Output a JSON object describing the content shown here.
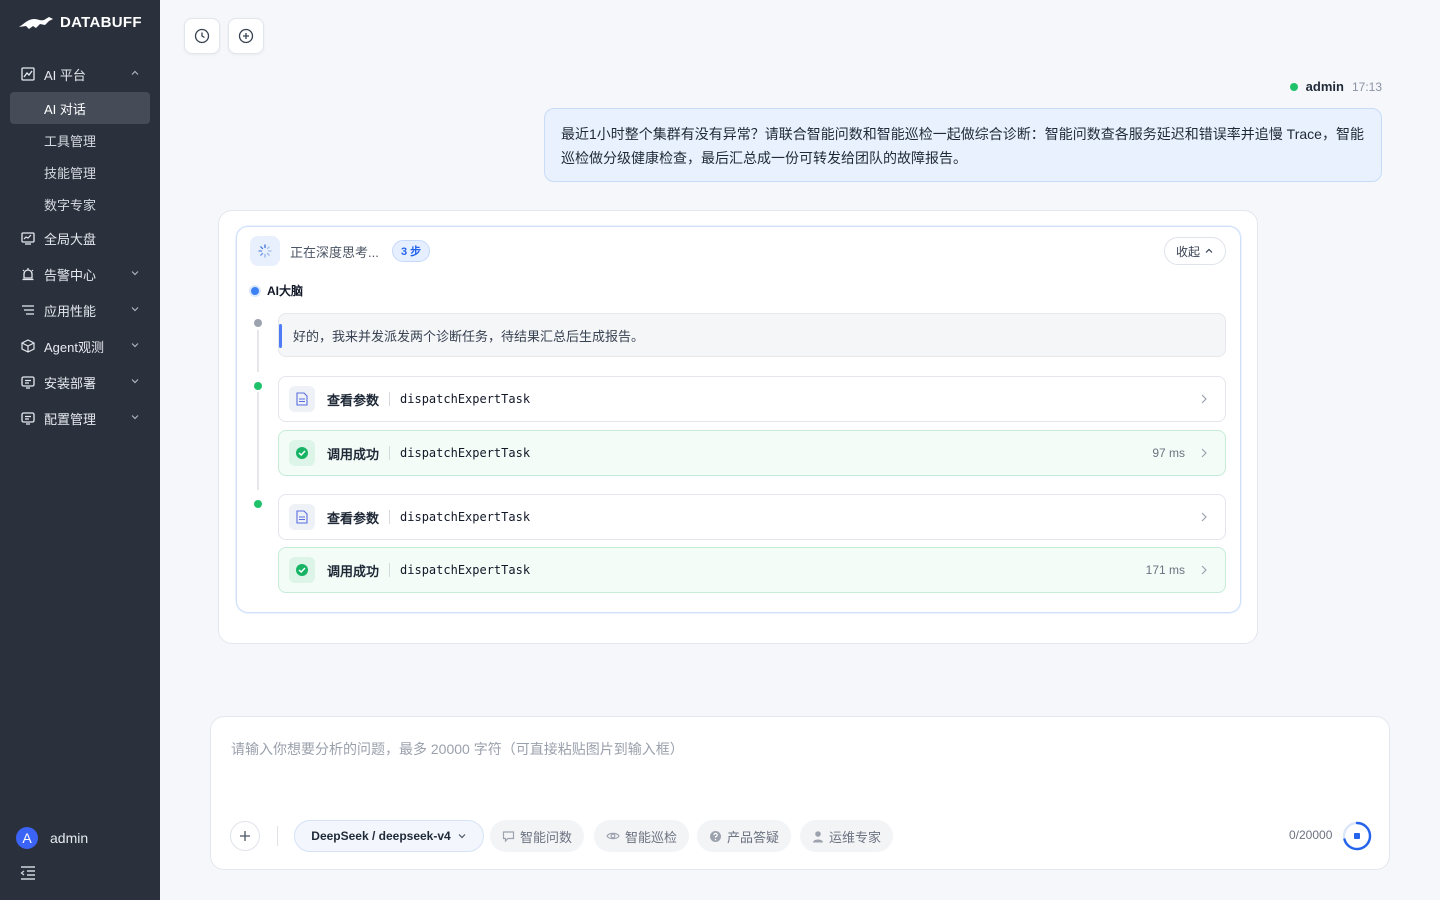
{
  "brand": {
    "name": "DATABUFF"
  },
  "sidebar": {
    "groups": [
      {
        "label": "AI 平台",
        "icon": "ai-chart-icon",
        "expanded": true,
        "children": [
          {
            "label": "AI 对话",
            "active": true
          },
          {
            "label": "工具管理"
          },
          {
            "label": "技能管理"
          },
          {
            "label": "数字专家"
          }
        ]
      },
      {
        "label": "全局大盘",
        "icon": "dashboard-icon"
      },
      {
        "label": "告警中心",
        "icon": "alarm-icon"
      },
      {
        "label": "应用性能",
        "icon": "apm-icon"
      },
      {
        "label": "Agent观测",
        "icon": "cube-icon"
      },
      {
        "label": "安装部署",
        "icon": "deploy-icon"
      },
      {
        "label": "配置管理",
        "icon": "config-icon"
      }
    ],
    "user": {
      "initial": "A",
      "name": "admin"
    }
  },
  "toolbar": {
    "history_icon": "clock-icon",
    "new_icon": "plus-circle-icon"
  },
  "user_message": {
    "author": "admin",
    "time": "17:13",
    "text": "最近1小时整个集群有没有异常？请联合智能问数和智能巡检一起做综合诊断：智能问数查各服务延迟和错误率并追慢 Trace，智能巡检做分级健康检查，最后汇总成一份可转发给团队的故障报告。"
  },
  "ai": {
    "thinking": "正在深度思考...",
    "steps": "3 步",
    "collapse": "收起",
    "agent": "AI大脑",
    "reply": "好的，我来并发派发两个诊断任务，待结果汇总后生成报告。",
    "tool_calls": [
      {
        "label": "查看参数",
        "name": "dispatchExpertTask",
        "status": "params",
        "ms": ""
      },
      {
        "label": "调用成功",
        "name": "dispatchExpertTask",
        "status": "success",
        "ms": "97 ms"
      },
      {
        "label": "查看参数",
        "name": "dispatchExpertTask",
        "status": "params",
        "ms": ""
      },
      {
        "label": "调用成功",
        "name": "dispatchExpertTask",
        "status": "success",
        "ms": "171 ms"
      }
    ]
  },
  "input": {
    "placeholder": "请输入你想要分析的问题，最多 20000 字符（可直接粘贴图片到输入框）",
    "model": "DeepSeek / deepseek-v4",
    "chips": [
      {
        "label": "智能问数",
        "icon": "chat-icon"
      },
      {
        "label": "智能巡检",
        "icon": "eye-icon"
      },
      {
        "label": "产品答疑",
        "icon": "question-icon"
      },
      {
        "label": "运维专家",
        "icon": "person-icon"
      }
    ],
    "counter": "0/20000"
  },
  "colors": {
    "accent": "#2563eb",
    "sidebar": "#2b313c",
    "success": "#1fc26b"
  }
}
